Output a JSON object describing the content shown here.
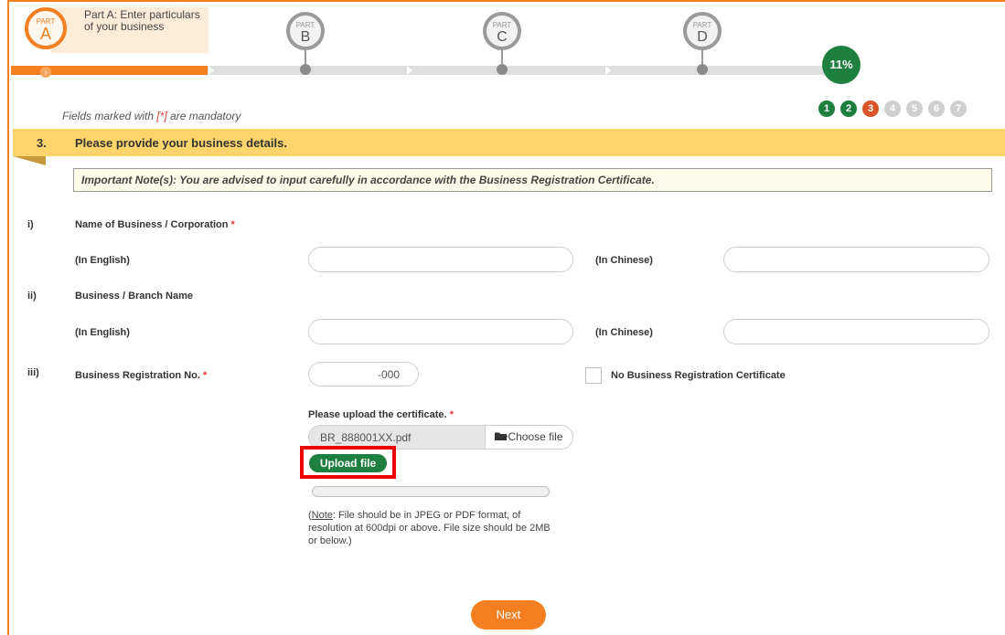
{
  "header": {
    "part_a": {
      "small": "PART",
      "letter": "A",
      "tip": "Part A: Enter particulars of your business"
    },
    "part_b": {
      "small": "PART",
      "letter": "B"
    },
    "part_c": {
      "small": "PART",
      "letter": "C"
    },
    "part_d": {
      "small": "PART",
      "letter": "D"
    },
    "arrow": "›",
    "progress_percent": "11%",
    "steps": [
      "1",
      "2",
      "3",
      "4",
      "5",
      "6",
      "7"
    ],
    "current_step": 3
  },
  "mandatory": {
    "prefix": "Fields marked with ",
    "star": "[*]",
    "suffix": " are mandatory"
  },
  "section": {
    "number": "3.",
    "title": "Please provide your business details.",
    "note": "Important Note(s): You are advised to input carefully in accordance with the Business Registration Certificate."
  },
  "form": {
    "q1": {
      "num": "i)",
      "label": "Name of Business / Corporation",
      "required": "*",
      "en_label": "(In English)",
      "zh_label": "(In Chinese)",
      "en_value": "",
      "zh_value": ""
    },
    "q2": {
      "num": "ii)",
      "label": "Business / Branch Name",
      "en_label": "(In English)",
      "zh_label": "(In Chinese)",
      "en_value": "",
      "zh_value": ""
    },
    "q3": {
      "num": "iii)",
      "label": "Business Registration No.",
      "required": "*",
      "value": "-000",
      "no_cert_label": "No Business Registration Certificate",
      "no_cert_checked": false
    },
    "upload": {
      "label": "Please upload the certificate.",
      "required": "*",
      "file_name": "BR_888001XX.pdf",
      "choose_label": "Choose file",
      "upload_label": "Upload file",
      "progress": 0,
      "note_prefix": "(",
      "note_u": "Note",
      "note_text": ": File should be in JPEG or PDF format, of resolution at 600dpi or above. File size should be 2MB or below.)"
    }
  },
  "footer": {
    "next_label": "Next"
  },
  "colors": {
    "accent": "#f47f20",
    "success": "#1e7f3e",
    "current": "#d9542b",
    "banner": "#fed46b",
    "highlight": "#e00000"
  }
}
